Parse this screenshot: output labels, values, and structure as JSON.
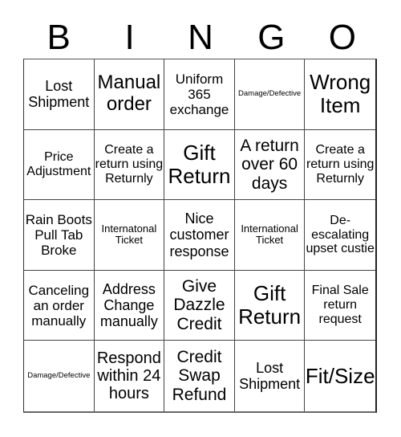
{
  "header": {
    "letters": [
      "B",
      "I",
      "N",
      "G",
      "O"
    ]
  },
  "cells": [
    {
      "text": "Lost Shipment",
      "size": "s18"
    },
    {
      "text": "Manual order",
      "size": "s24"
    },
    {
      "text": "Uniform 365 exchange",
      "size": "s17"
    },
    {
      "text": "Damage/Defective",
      "size": "s9"
    },
    {
      "text": "Wrong Item",
      "size": "s26"
    },
    {
      "text": "Price Adjustment",
      "size": "s16"
    },
    {
      "text": "Create a return using Returnly",
      "size": "s16"
    },
    {
      "text": "Gift Return",
      "size": "s26"
    },
    {
      "text": "A return over 60 days",
      "size": "s21"
    },
    {
      "text": "Create a return using Returnly",
      "size": "s16"
    },
    {
      "text": "Rain Boots Pull Tab Broke",
      "size": "s17"
    },
    {
      "text": "Internatonal Ticket",
      "size": "s13"
    },
    {
      "text": "Nice customer response",
      "size": "s18"
    },
    {
      "text": "International Ticket",
      "size": "s13"
    },
    {
      "text": "De-escalating upset custie",
      "size": "s16"
    },
    {
      "text": "Canceling an order manually",
      "size": "s17"
    },
    {
      "text": "Address Change manually",
      "size": "s18"
    },
    {
      "text": "Give Dazzle Credit",
      "size": "s21"
    },
    {
      "text": "Gift Return",
      "size": "s26"
    },
    {
      "text": "Final Sale return request",
      "size": "s16"
    },
    {
      "text": "Damage/Defective",
      "size": "s9"
    },
    {
      "text": "Respond within 24 hours",
      "size": "s20"
    },
    {
      "text": "Credit Swap Refund",
      "size": "s21"
    },
    {
      "text": "Lost Shipment",
      "size": "s18"
    },
    {
      "text": "Fit/Size",
      "size": "s26"
    }
  ]
}
